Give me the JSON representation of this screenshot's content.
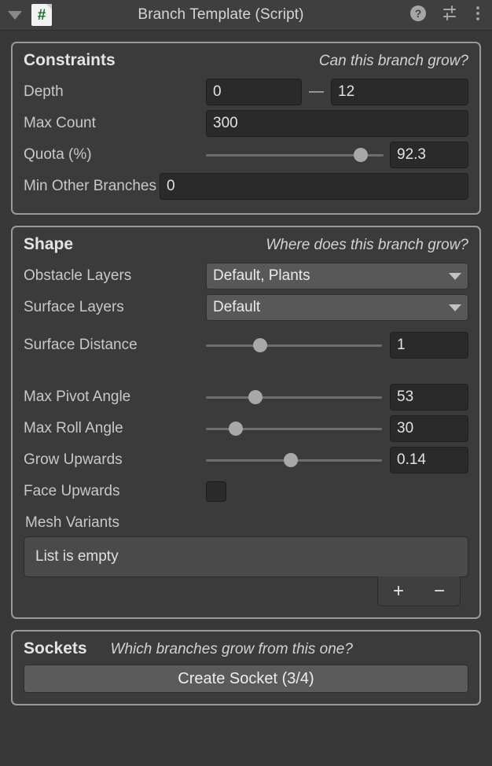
{
  "header": {
    "title": "Branch Template (Script)",
    "foldout_icon": "triangle-down-icon",
    "script_icon_glyph": "#",
    "help_icon": "help-icon",
    "preset_icon": "preset-sliders-icon",
    "menu_icon": "kebab-menu-icon"
  },
  "constraints": {
    "title": "Constraints",
    "hint": "Can this branch grow?",
    "depth": {
      "label": "Depth",
      "min": "0",
      "separator": "—",
      "max": "12"
    },
    "max_count": {
      "label": "Max Count",
      "value": "300"
    },
    "quota": {
      "label": "Quota (%)",
      "value": "92.3",
      "knob_percent": 87
    },
    "min_other_branches": {
      "label": "Min Other Branches",
      "value": "0"
    }
  },
  "shape": {
    "title": "Shape",
    "hint": "Where does this branch grow?",
    "obstacle_layers": {
      "label": "Obstacle Layers",
      "value": "Default, Plants"
    },
    "surface_layers": {
      "label": "Surface Layers",
      "value": "Default"
    },
    "surface_distance": {
      "label": "Surface Distance",
      "value": "1",
      "knob_percent": 31
    },
    "max_pivot_angle": {
      "label": "Max Pivot Angle",
      "value": "53",
      "knob_percent": 28
    },
    "max_roll_angle": {
      "label": "Max Roll Angle",
      "value": "30",
      "knob_percent": 17
    },
    "grow_upwards": {
      "label": "Grow Upwards",
      "value": "0.14",
      "knob_percent": 48
    },
    "face_upwards": {
      "label": "Face Upwards",
      "checked": false
    },
    "mesh_variants": {
      "label": "Mesh Variants",
      "empty_text": "List is empty",
      "add_label": "+",
      "remove_label": "−"
    }
  },
  "sockets": {
    "title": "Sockets",
    "hint": "Which branches grow from this one?",
    "create_button": "Create Socket (3/4)"
  }
}
